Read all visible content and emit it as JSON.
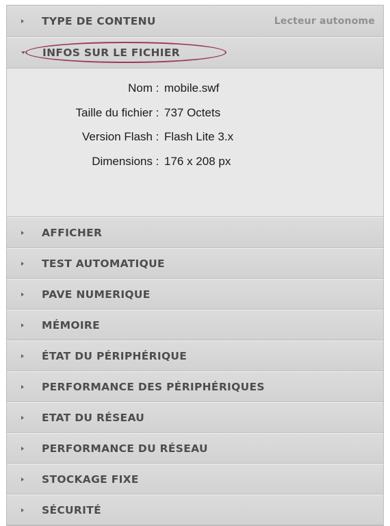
{
  "header": {
    "label": "TYPE DE CONTENU",
    "value": "Lecteur autonome"
  },
  "file_info": {
    "label": "INFOS SUR LE FICHIER",
    "separator": ":",
    "rows": [
      {
        "key": "Nom",
        "value": "mobile.swf"
      },
      {
        "key": "Taille du fichier",
        "value": "737 Octets"
      },
      {
        "key": "Version Flash",
        "value": "Flash Lite 3.x"
      },
      {
        "key": "Dimensions",
        "value": "176 x 208 px"
      }
    ]
  },
  "sections": [
    {
      "label": "AFFICHER"
    },
    {
      "label": "TEST AUTOMATIQUE"
    },
    {
      "label": "PAVE NUMERIQUE"
    },
    {
      "label": "MÉMOIRE"
    },
    {
      "label": "ÉTAT DU PÉRIPHÉRIQUE"
    },
    {
      "label": "PERFORMANCE DES PÉRIPHÉRIQUES"
    },
    {
      "label": "ETAT DU RÉSEAU"
    },
    {
      "label": "PERFORMANCE DU RÉSEAU"
    },
    {
      "label": "STOCKAGE FIXE"
    },
    {
      "label": "SÉCURITÉ"
    }
  ],
  "colors": {
    "annotation": "#9a3b5c",
    "panel": "#d8d8d8",
    "content": "#e8e8e8"
  },
  "icons": {
    "collapsed": "triangle-right-icon",
    "expanded": "triangle-down-icon"
  }
}
